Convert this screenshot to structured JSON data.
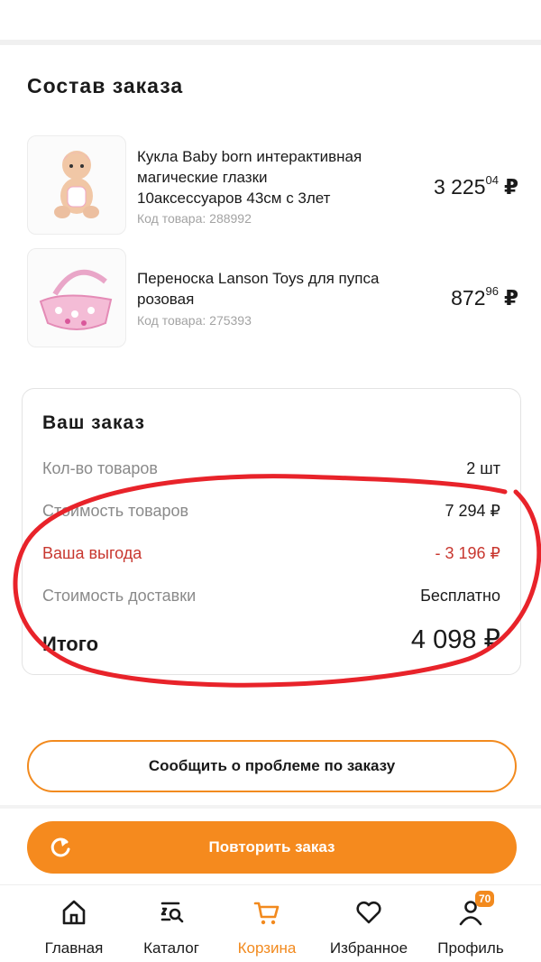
{
  "section_title": "Состав заказа",
  "products": [
    {
      "name_line1": "Кукла Baby born интерактивная",
      "name_line2": "магические глазки",
      "name_line3": "10аксессуаров 43см с 3лет",
      "code": "Код товара: 288992",
      "price_int": "3 225",
      "price_cents": "04",
      "currency": "₽"
    },
    {
      "name_line1": "Переноска Lanson Toys для пупса",
      "name_line2": "розовая",
      "code": "Код товара: 275393",
      "price_int": "872",
      "price_cents": "96",
      "currency": "₽"
    }
  ],
  "summary": {
    "title": "Ваш заказ",
    "rows": [
      {
        "label": "Кол-во товаров",
        "value": "2 шт"
      },
      {
        "label": "Стоимость товаров",
        "value": "7 294 ₽"
      },
      {
        "label": "Ваша выгода",
        "value": "- 3 196 ₽"
      },
      {
        "label": "Стоимость доставки",
        "value": "Бесплатно"
      },
      {
        "label": "Итого",
        "value": "4 098 ₽"
      }
    ]
  },
  "buttons": {
    "report_problem": "Сообщить о проблеме по заказу",
    "repeat_order": "Повторить заказ"
  },
  "tabbar": {
    "items": [
      {
        "label": "Главная",
        "icon": "home-icon"
      },
      {
        "label": "Каталог",
        "icon": "catalog-icon"
      },
      {
        "label": "Корзина",
        "icon": "cart-icon"
      },
      {
        "label": "Избранное",
        "icon": "heart-icon"
      },
      {
        "label": "Профиль",
        "icon": "profile-icon"
      }
    ],
    "active": "Корзина",
    "profile_badge": "70"
  },
  "colors": {
    "accent": "#f58a1e",
    "benefit": "#c8372f",
    "annotation": "#e8232a"
  }
}
